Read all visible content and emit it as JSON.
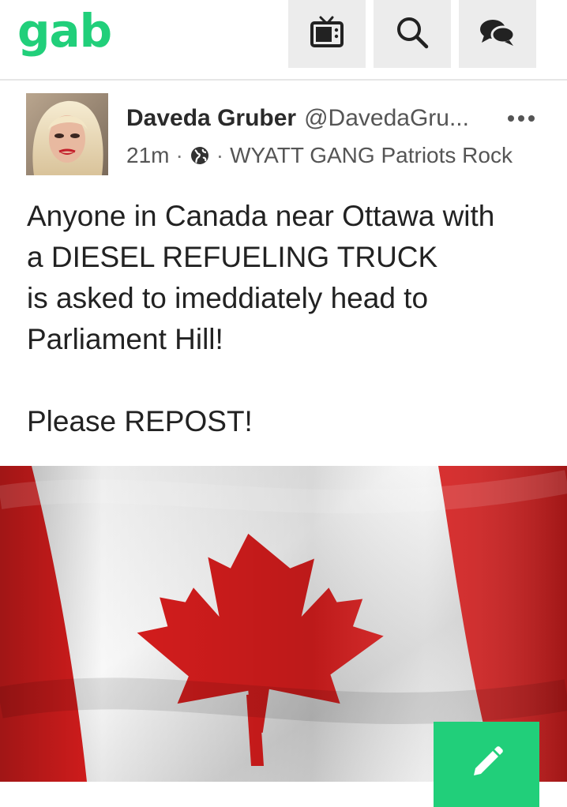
{
  "app": {
    "logo_text": "gab",
    "brand_color": "#21cf7a"
  },
  "nav": {
    "items": [
      {
        "icon": "tv-icon"
      },
      {
        "icon": "search-icon"
      },
      {
        "icon": "chat-icon"
      }
    ]
  },
  "post": {
    "display_name": "Daveda Gruber",
    "handle": "@DavedaGru...",
    "time": "21m",
    "visibility_icon": "globe-icon",
    "group": "WYATT GANG Patriots Rock",
    "body": {
      "line1": "Anyone in Canada near Ottawa with",
      "line2": "a DIESEL REFUELING TRUCK",
      "line3": "is asked to imeddiately head to",
      "line4": "Parliament Hill!",
      "line5": "Please REPOST!"
    },
    "media": {
      "subject": "Canadian flag",
      "colors": {
        "red": "#d61d1d",
        "white": "#f3f3f3"
      }
    }
  },
  "fab": {
    "icon": "pencil-icon"
  }
}
